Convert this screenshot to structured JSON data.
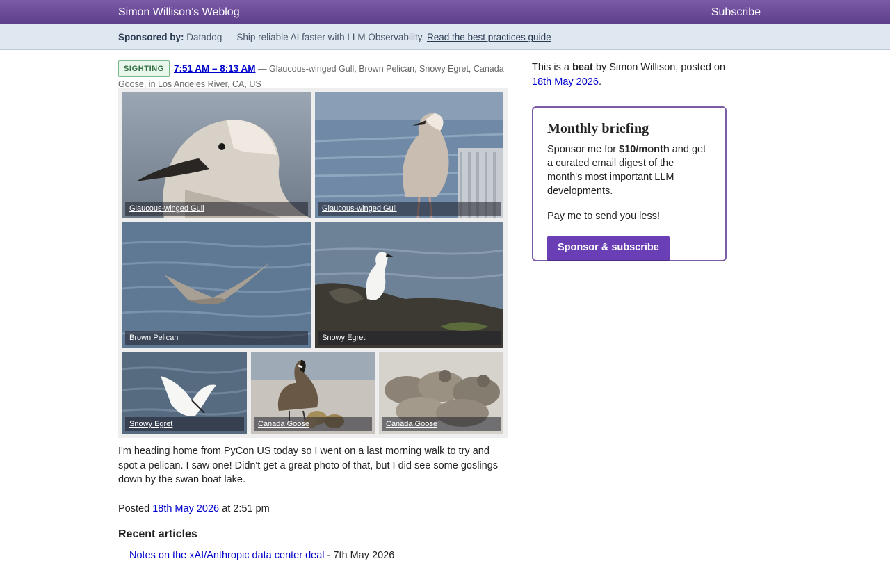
{
  "header": {
    "site_title": "Simon Willison’s Weblog",
    "subscribe_label": "Subscribe"
  },
  "sponsor": {
    "label": "Sponsored by:",
    "text": "Datadog — Ship reliable AI faster with LLM Observability.",
    "link_text": "Read the best practices guide"
  },
  "entry": {
    "badge": "SIGHTING",
    "time_range": "7:51 AM – 8:13 AM",
    "separator": "—",
    "species_list": "Glaucous-winged Gull, Brown Pelican, Snowy Egret, Canada Goose",
    "location_prefix": ", in ",
    "location": "Los Angeles River, CA, US",
    "photos": [
      {
        "caption": "Glaucous-winged Gull"
      },
      {
        "caption": "Glaucous-winged Gull"
      },
      {
        "caption": "Brown Pelican"
      },
      {
        "caption": "Snowy Egret"
      },
      {
        "caption": "Snowy Egret"
      },
      {
        "caption": "Canada Goose"
      },
      {
        "caption": "Canada Goose"
      }
    ],
    "body": "I'm heading home from PyCon US today so I went on a last morning walk to try and spot a pelican. I saw one! Didn't get a great photo of that, but I did see some goslings down by the swan boat lake.",
    "posted_prefix": "Posted",
    "posted_date": "18th May 2026",
    "posted_time": "at 2:51 pm"
  },
  "recent": {
    "heading": "Recent articles",
    "items": [
      {
        "title": "Notes on the xAI/Anthropic data center deal",
        "date": "- 7th May 2026"
      }
    ]
  },
  "sidebar": {
    "beat_prefix": "This is a",
    "beat_word": "beat",
    "beat_by": "by Simon Willison, posted on",
    "beat_date": "18th May 2026",
    "beat_end": ".",
    "briefing": {
      "title": "Monthly briefing",
      "desc_prefix": "Sponsor me for",
      "price": "$10/month",
      "desc_suffix": "and get a curated email digest of the month's most important LLM developments.",
      "pay_text": "Pay me to send you less!",
      "button_label": "Sponsor & subscribe"
    }
  },
  "colors": {
    "header_purple": "#5e3f8b",
    "link_blue": "#0000cc",
    "button_purple": "#6a3fb5",
    "sponsor_bg": "#dfe7f1"
  }
}
